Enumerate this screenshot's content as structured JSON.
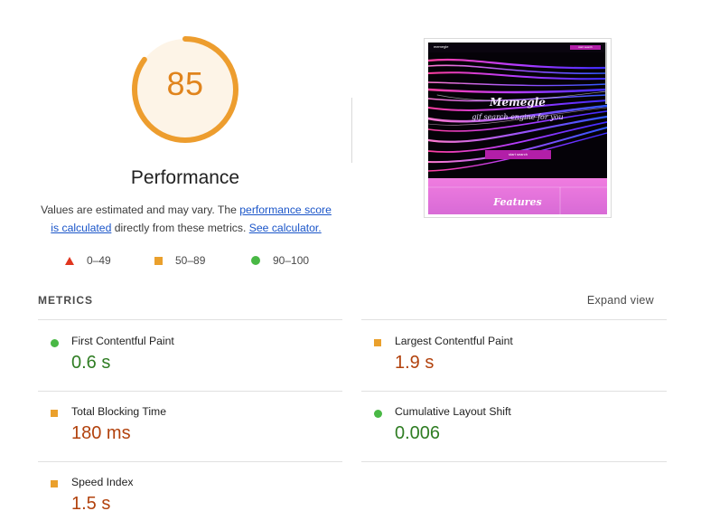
{
  "score": {
    "value": "85",
    "value_fraction": 0.85,
    "title": "Performance",
    "color": "#ed9d2e",
    "bg_color": "#fdf4e7"
  },
  "description": {
    "text1": "Values are estimated and may vary. The ",
    "link1": "performance score is calculated",
    "text2": " directly from these metrics. ",
    "link2": "See calculator."
  },
  "legend": [
    {
      "shape": "triangle",
      "color": "#e0351e",
      "range": "0–49"
    },
    {
      "shape": "square",
      "color": "#eaa02c",
      "range": "50–89"
    },
    {
      "shape": "circle",
      "color": "#49b845",
      "range": "90–100"
    }
  ],
  "screenshot": {
    "brand": "memegle",
    "nav_button": "start search",
    "hero_title": "Memegle",
    "hero_subtitle": "gif search engine for you",
    "cta_button": "start search",
    "section_title": "Features"
  },
  "metrics_header": {
    "label": "METRICS",
    "expand": "Expand view"
  },
  "metrics": [
    {
      "name": "First Contentful Paint",
      "value": "0.6 s",
      "rating": "good"
    },
    {
      "name": "Largest Contentful Paint",
      "value": "1.9 s",
      "rating": "average"
    },
    {
      "name": "Total Blocking Time",
      "value": "180 ms",
      "rating": "average"
    },
    {
      "name": "Cumulative Layout Shift",
      "value": "0.006",
      "rating": "good"
    },
    {
      "name": "Speed Index",
      "value": "1.5 s",
      "rating": "average"
    }
  ]
}
